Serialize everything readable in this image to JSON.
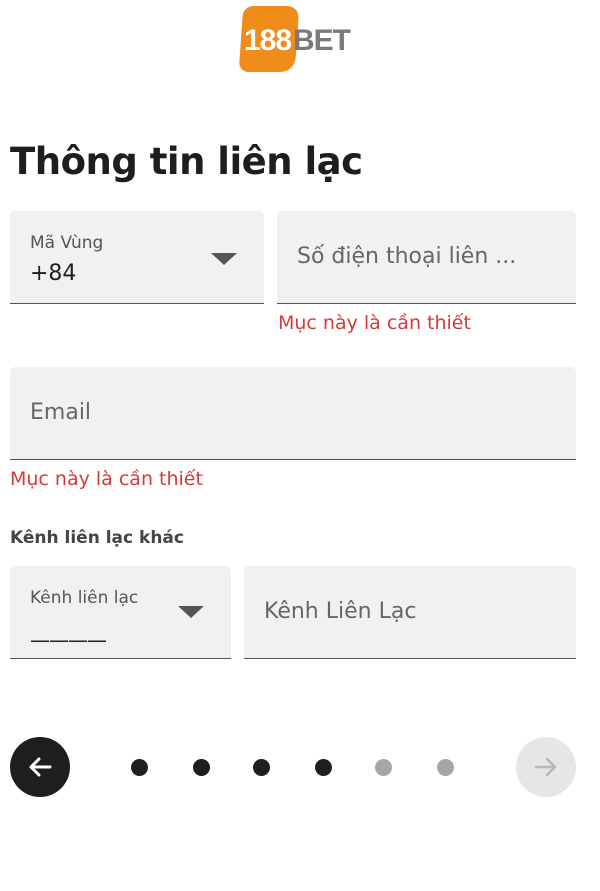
{
  "logo": {
    "number": "188",
    "word": "BET"
  },
  "title": "Thông tin liên lạc",
  "phone": {
    "area_code_label": "Mã Vùng",
    "area_code_value": "+84",
    "phone_placeholder": "Số điện thoại liên ...",
    "error": "Mục này là cần thiết"
  },
  "email": {
    "placeholder": "Email",
    "error": "Mục này là cần thiết"
  },
  "other_contact": {
    "section_label": "Kênh liên lạc khác",
    "channel_label": "Kênh liên lạc",
    "channel_value": "————",
    "channel_placeholder": "Kênh Liên Lạc"
  },
  "navigation": {
    "steps_total": 6,
    "steps_active": 4
  },
  "colors": {
    "brand_orange": "#f08c1a",
    "error_red": "#d43a3a",
    "field_bg": "#f1f1f1",
    "dark": "#1e1e1e"
  },
  "icons": {
    "back": "arrow-left-icon",
    "next": "arrow-right-icon",
    "dropdown": "caret-down-icon"
  }
}
